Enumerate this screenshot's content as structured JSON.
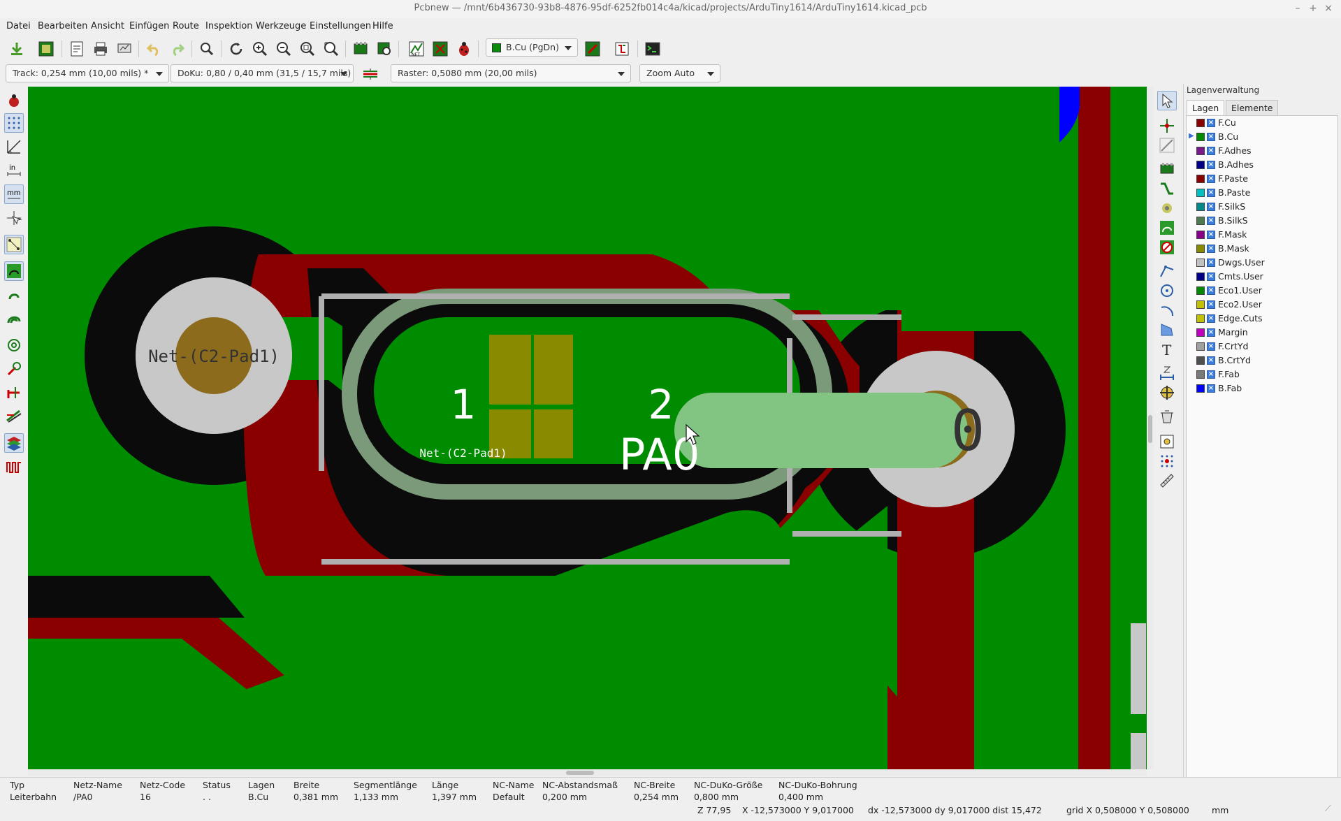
{
  "window": {
    "title": "Pcbnew — /mnt/6b436730-93b8-4876-95df-6252fb014c4a/kicad/projects/ArduTiny1614/ArduTiny1614.kicad_pcb",
    "controls": {
      "minimize": "–",
      "maximize": "+",
      "close": "×"
    }
  },
  "menu": [
    "Datei",
    "Bearbeiten",
    "Ansicht",
    "Einfügen",
    "Route",
    "Inspektion",
    "Werkzeuge",
    "Einstellungen",
    "Hilfe"
  ],
  "toolbar": {
    "active_layer": "B.Cu (PgDn)",
    "active_layer_color": "#0a8a0a",
    "icons": [
      "save-icon",
      "board-setup-icon",
      "page-setup-icon",
      "print-icon",
      "plot-icon",
      "undo-icon",
      "redo-icon",
      "find-icon",
      "redraw-icon",
      "zoom-in-icon",
      "zoom-out-icon",
      "zoom-fit-icon",
      "zoom-selection-icon",
      "footprint-editor-icon",
      "footprint-browser-icon",
      "netlist-icon",
      "update-pcb-icon",
      "drc-icon",
      "layer-pair-icon",
      "microwave-icon",
      "scripting-icon"
    ]
  },
  "toolbar2": {
    "track": "Track: 0,254 mm (10,00 mils) *",
    "via": "DoKu: 0,80 / 0,40 mm (31,5 / 15,7 mils) *",
    "grid": "Raster: 0,5080 mm (20,00 mils)",
    "zoom": "Zoom Auto"
  },
  "canvas": {
    "pad_left_net": "Net-(C2-Pad1)",
    "pad_center_number_1": "1",
    "pad_center_net": "Net-(C2-Pad1)",
    "pad_center_number_2": "2",
    "pad_right_net_partial": "PA0",
    "pad_right_number_partial": "0",
    "colors": {
      "b_cu": "#008c00",
      "f_cu": "#8a0000",
      "hole": "#c8c8c8",
      "drill": "#8c6c1c",
      "highlight_track": "#82c582",
      "b_fab": "#0000ff"
    }
  },
  "layers_panel": {
    "title": "Lagenverwaltung",
    "tabs": [
      "Lagen",
      "Elemente"
    ],
    "active_layer": "B.Cu",
    "items": [
      {
        "name": "F.Cu",
        "color": "#8a0000"
      },
      {
        "name": "B.Cu",
        "color": "#008c00"
      },
      {
        "name": "F.Adhes",
        "color": "#7a1a8a"
      },
      {
        "name": "B.Adhes",
        "color": "#00008a"
      },
      {
        "name": "F.Paste",
        "color": "#8a0000"
      },
      {
        "name": "B.Paste",
        "color": "#00c2c2"
      },
      {
        "name": "F.SilkS",
        "color": "#008a8a"
      },
      {
        "name": "B.SilkS",
        "color": "#4f7a4f"
      },
      {
        "name": "F.Mask",
        "color": "#8a008a"
      },
      {
        "name": "B.Mask",
        "color": "#8a8a00"
      },
      {
        "name": "Dwgs.User",
        "color": "#c2c2c2"
      },
      {
        "name": "Cmts.User",
        "color": "#00008a"
      },
      {
        "name": "Eco1.User",
        "color": "#008a00"
      },
      {
        "name": "Eco2.User",
        "color": "#c2c200"
      },
      {
        "name": "Edge.Cuts",
        "color": "#c2c200"
      },
      {
        "name": "Margin",
        "color": "#c200c2"
      },
      {
        "name": "F.CrtYd",
        "color": "#a0a0a0"
      },
      {
        "name": "B.CrtYd",
        "color": "#505050"
      },
      {
        "name": "F.Fab",
        "color": "#7a7a7a"
      },
      {
        "name": "B.Fab",
        "color": "#0000ff"
      }
    ]
  },
  "status": {
    "columns": [
      {
        "label": "Typ",
        "value": "Leiterbahn"
      },
      {
        "label": "Netz-Name",
        "value": "/PA0"
      },
      {
        "label": "Netz-Code",
        "value": "16"
      },
      {
        "label": "Status",
        "value": ". ."
      },
      {
        "label": "Lagen",
        "value": "B.Cu"
      },
      {
        "label": "Breite",
        "value": "0,381 mm"
      },
      {
        "label": "Segmentlänge",
        "value": "1,133 mm"
      },
      {
        "label": "Länge",
        "value": "1,397 mm"
      },
      {
        "label": "NC-Name",
        "value": "Default"
      },
      {
        "label": "NC-Abstandsmaß",
        "value": "0,200 mm"
      },
      {
        "label": "NC-Breite",
        "value": "0,254 mm"
      },
      {
        "label": "NC-DuKo-Größe",
        "value": "0,800 mm"
      },
      {
        "label": "NC-DuKo-Bohrung",
        "value": "0,400 mm"
      }
    ],
    "zoom": "Z 77,95",
    "abs_coords": "X -12,573000  Y 9,017000",
    "rel_coords": "dx -12,573000  dy 9,017000  dist 15,472",
    "grid": "grid X 0,508000  Y 0,508000",
    "units": "mm"
  }
}
